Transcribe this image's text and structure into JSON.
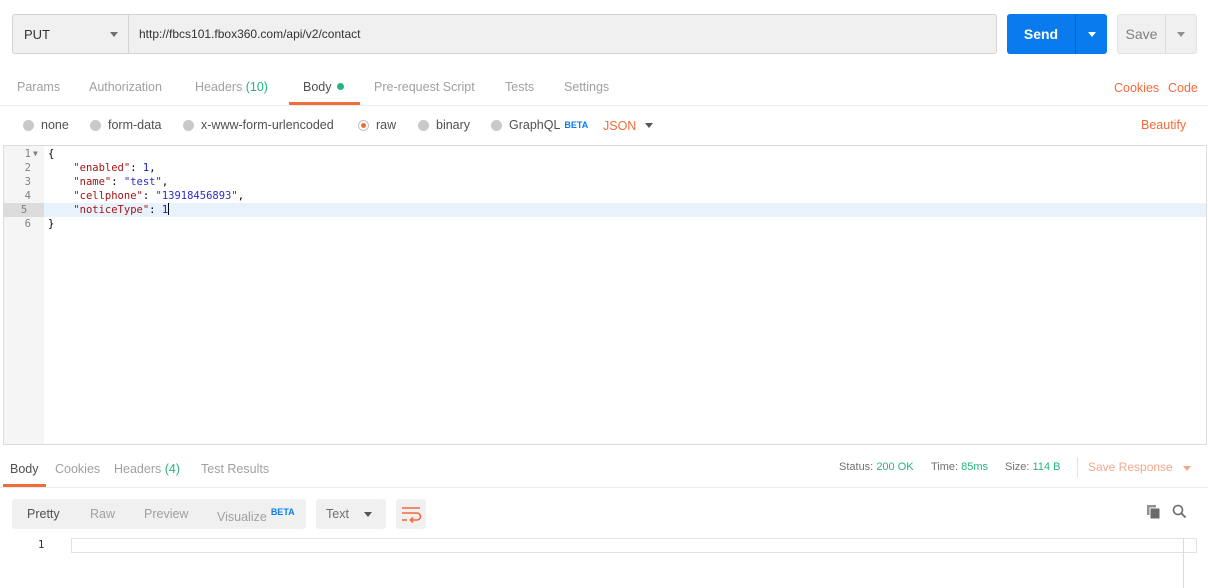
{
  "request": {
    "method": "PUT",
    "url": "http://fbcs101.fbox360.com/api/v2/contact",
    "send_label": "Send",
    "save_label": "Save"
  },
  "request_tabs": {
    "params": "Params",
    "authorization": "Authorization",
    "headers": "Headers",
    "headers_count": "(10)",
    "body": "Body",
    "prerequest": "Pre-request Script",
    "tests": "Tests",
    "settings": "Settings",
    "cookies": "Cookies",
    "code": "Code"
  },
  "body_types": {
    "none": "none",
    "form_data": "form-data",
    "urlencoded": "x-www-form-urlencoded",
    "raw": "raw",
    "binary": "binary",
    "graphql": "GraphQL",
    "beta": "BETA",
    "format": "JSON",
    "beautify": "Beautify",
    "selected": "raw"
  },
  "editor": {
    "line_numbers": [
      "1",
      "2",
      "3",
      "4",
      "5",
      "6"
    ],
    "open_brace": "{",
    "close_brace": "}",
    "key_enabled": "\"enabled\"",
    "val_enabled": "1",
    "key_name": "\"name\"",
    "val_name": "\"test\"",
    "key_cellphone": "\"cellphone\"",
    "val_cellphone": "\"13918456893\"",
    "key_notice": "\"noticeType\"",
    "val_notice": "1"
  },
  "response": {
    "tab_body": "Body",
    "tab_cookies": "Cookies",
    "tab_headers": "Headers",
    "headers_count": "(4)",
    "tab_tests": "Test Results",
    "status_label": "Status:",
    "status_value": "200 OK",
    "time_label": "Time:",
    "time_value": "85ms",
    "size_label": "Size:",
    "size_value": "114 B",
    "save_response": "Save Response",
    "view_pretty": "Pretty",
    "view_raw": "Raw",
    "view_preview": "Preview",
    "view_visualize": "Visualize",
    "visualize_beta": "BETA",
    "text_format": "Text",
    "line_number": "1"
  },
  "colors": {
    "accent": "#F26B3A",
    "send_blue": "#097BED",
    "success_green": "#26b47f"
  }
}
